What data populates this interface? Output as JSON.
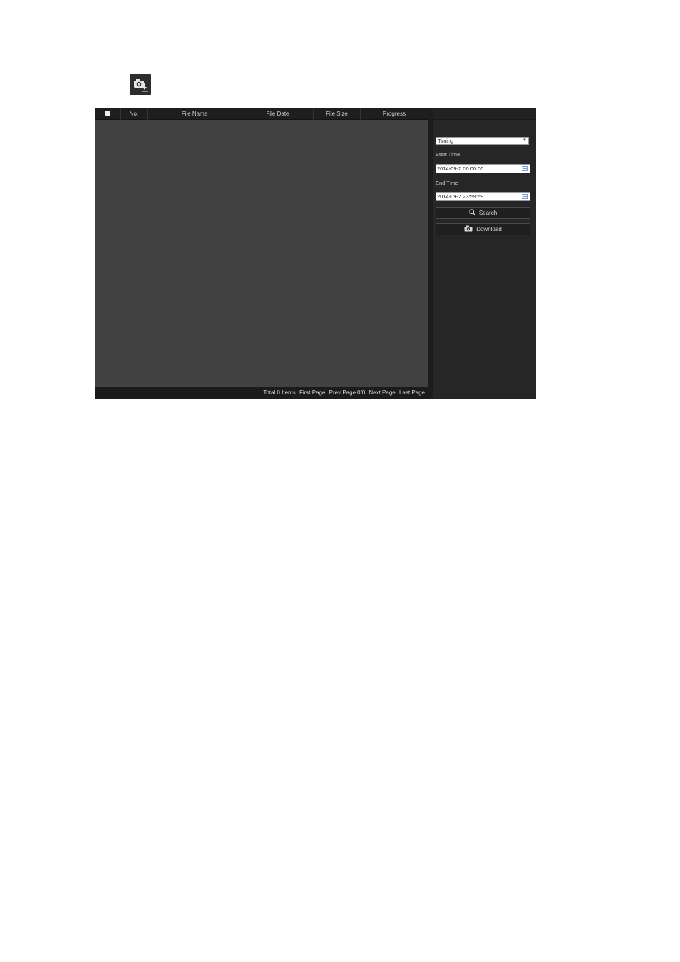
{
  "page": {
    "snapshot_icon": "camera-download-icon"
  },
  "list": {
    "columns": [
      "No.",
      "File Name",
      "File Date",
      "File Size",
      "Progress"
    ],
    "pager": {
      "total": "Total 0 Items",
      "first": "First Page",
      "prev": "Prev Page",
      "page": "0/0",
      "next": "Next Page",
      "last": "Last Page"
    }
  },
  "sidebar": {
    "type_select": "Timing",
    "start_label": "Start Time",
    "start_value": "2014-09-2 00:00:00",
    "end_label": "End Time",
    "end_value": "2014-09-2 23:59:59",
    "search_label": "Search",
    "download_label": "Download"
  },
  "colors": {
    "panel_bg": "#262626",
    "list_bg": "#414141",
    "header_bg": "#1e1e1e"
  }
}
